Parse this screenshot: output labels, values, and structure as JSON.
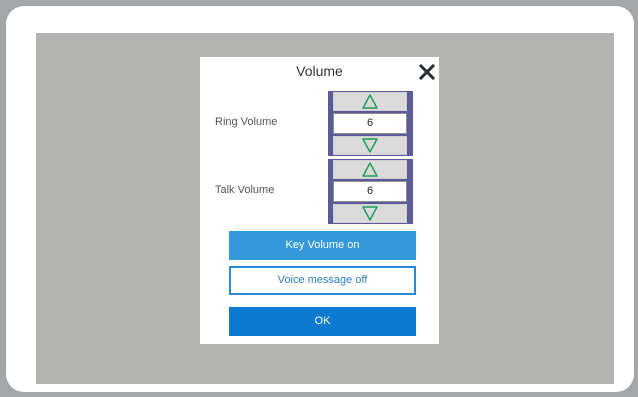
{
  "dialog": {
    "title": "Volume",
    "close_icon": "close-icon"
  },
  "ring_volume": {
    "label": "Ring Volume",
    "value": "6",
    "up_icon": "triangle-up-icon",
    "down_icon": "triangle-down-icon"
  },
  "talk_volume": {
    "label": "Talk Volume",
    "value": "6",
    "up_icon": "triangle-up-icon",
    "down_icon": "triangle-down-icon"
  },
  "buttons": {
    "key_volume": "Key Volume on",
    "voice_message": "Voice message off",
    "ok": "OK"
  },
  "colors": {
    "screen_background": "#b3b4b2",
    "spinner_frame": "#5b5a9a",
    "arrow_outline": "#1fa05a",
    "key_volume_button": "#3399db",
    "ok_button": "#0b7ad0"
  }
}
